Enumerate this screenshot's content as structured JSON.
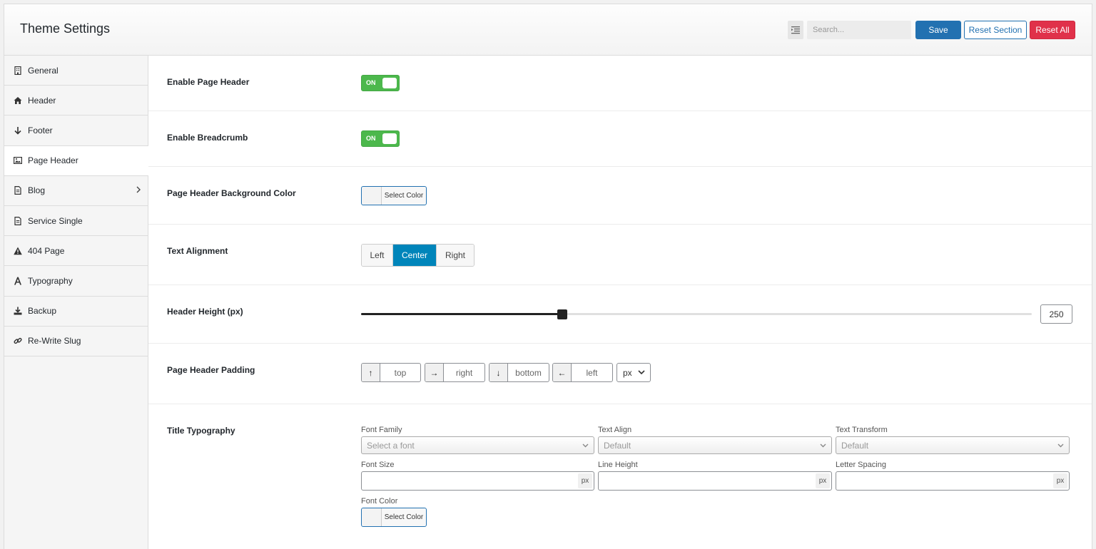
{
  "header": {
    "title": "Theme Settings",
    "search_placeholder": "Search...",
    "save_label": "Save",
    "reset_section_label": "Reset Section",
    "reset_all_label": "Reset All"
  },
  "sidebar": {
    "items": [
      {
        "label": "General",
        "icon": "building-icon",
        "active": false
      },
      {
        "label": "Header",
        "icon": "home-icon",
        "active": false
      },
      {
        "label": "Footer",
        "icon": "arrow-down-icon",
        "active": false
      },
      {
        "label": "Page Header",
        "icon": "image-icon",
        "active": true
      },
      {
        "label": "Blog",
        "icon": "document-icon",
        "active": false,
        "has_children": true
      },
      {
        "label": "Service Single",
        "icon": "document-icon",
        "active": false
      },
      {
        "label": "404 Page",
        "icon": "warning-icon",
        "active": false
      },
      {
        "label": "Typography",
        "icon": "font-icon",
        "active": false
      },
      {
        "label": "Backup",
        "icon": "download-icon",
        "active": false
      },
      {
        "label": "Re-Write Slug",
        "icon": "link-icon",
        "active": false
      }
    ]
  },
  "fields": {
    "enable_page_header": {
      "label": "Enable Page Header",
      "state": "ON"
    },
    "enable_breadcrumb": {
      "label": "Enable Breadcrumb",
      "state": "ON"
    },
    "bg_color": {
      "label": "Page Header Background Color",
      "button": "Select Color"
    },
    "text_alignment": {
      "label": "Text Alignment",
      "options": [
        "Left",
        "Center",
        "Right"
      ],
      "selected": "Center"
    },
    "header_height": {
      "label": "Header Height (px)",
      "value": "250",
      "fraction": 0.3
    },
    "padding": {
      "label": "Page Header Padding",
      "top": "top",
      "right": "right",
      "bottom": "bottom",
      "left": "left",
      "unit": "px"
    },
    "title_typography": {
      "label": "Title Typography",
      "font_family_label": "Font Family",
      "font_family_value": "Select a font",
      "text_align_label": "Text Align",
      "text_align_value": "Default",
      "text_transform_label": "Text Transform",
      "text_transform_value": "Default",
      "font_size_label": "Font Size",
      "line_height_label": "Line Height",
      "letter_spacing_label": "Letter Spacing",
      "unit": "px",
      "font_color_label": "Font Color",
      "font_color_button": "Select Color"
    }
  },
  "colors": {
    "primary": "#2271b1",
    "danger": "#e0314a",
    "toggle_on": "#4cb84c",
    "segment_active": "#0085ba"
  }
}
